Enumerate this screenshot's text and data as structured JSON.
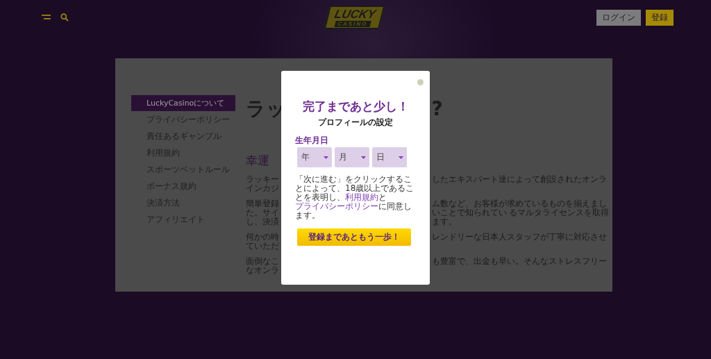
{
  "header": {
    "logo": {
      "top": "LUCKY",
      "bottom": "CASINO"
    },
    "buttons": [
      {
        "label": "ログイン",
        "kind": "secondary"
      },
      {
        "label": "登録",
        "kind": "primary"
      }
    ]
  },
  "sidebar": {
    "items": [
      {
        "label": "LuckyCasinoについて",
        "selected": true
      },
      {
        "label": "プライバシーポリシー",
        "selected": false
      },
      {
        "label": "責任あるギャンブル",
        "selected": false
      },
      {
        "label": "利用規約",
        "selected": false
      },
      {
        "label": "スポーツベットルール",
        "selected": false
      },
      {
        "label": "ボーナス規約",
        "selected": false
      },
      {
        "label": "決済方法",
        "selected": false
      },
      {
        "label": "アフィリエイト",
        "selected": false
      }
    ]
  },
  "article": {
    "heading": {
      "left": "ラッ",
      "right": "?"
    },
    "subheading": "幸運",
    "paragraphs": [
      [
        {
          "left": "ラッキー",
          "right": "したエキスパート達によって創設されたオンラ"
        },
        {
          "left": "インカジ"
        }
      ],
      [
        {
          "left": "簡単登録",
          "right": "ム数など、お客様が求めているものを揃えまし"
        },
        {
          "left": "た。サイ",
          "right": "いことで知られてい るマルタライセンスを取得"
        },
        {
          "left": "し、決済",
          "right": "ます。"
        }
      ],
      [
        {
          "left": "何かの時",
          "right": "レンドリーな日本人スタッフが丁寧に対応させ"
        },
        {
          "left": "ていただ"
        }
      ],
      [
        {
          "left": "面倒なこ",
          "right": "も豊富で、出金も早い。そんなストレスフリー"
        },
        {
          "left": "なオンラ"
        }
      ]
    ]
  },
  "modal": {
    "title": "完了まであと少し！",
    "subtitle": "プロフィールの設定",
    "birthdate_label": "生年月日",
    "selects": [
      {
        "label": "年"
      },
      {
        "label": "月"
      },
      {
        "label": "日"
      }
    ],
    "consent": [
      {
        "kind": "text",
        "text": "「次に進む」をクリックすることによって、18歳以上であることを表明し、"
      },
      {
        "kind": "link",
        "text": "利用規約"
      },
      {
        "kind": "text",
        "text": "と"
      },
      {
        "kind": "link",
        "text": "プライバシーポリシー"
      },
      {
        "kind": "text",
        "text": "に同意します。"
      }
    ],
    "submit": "登録まであともう一歩！"
  }
}
